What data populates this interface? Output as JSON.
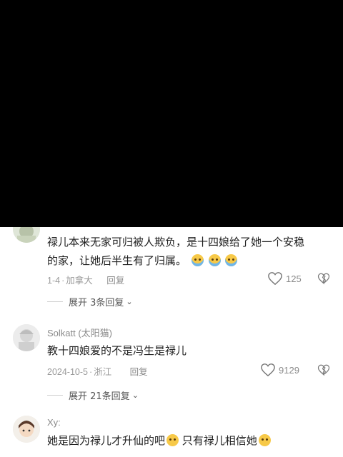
{
  "video": {},
  "comments": [
    {
      "text_line1": "禄儿本来无家可归被人欺负，是十四娘给了她一个安稳",
      "text_line2": "的家，让她后半生有了归属。",
      "emojis": [
        "loudly-crying-face",
        "loudly-crying-face",
        "loudly-crying-face"
      ],
      "date": "1-4",
      "location": "加拿大",
      "reply_label": "回复",
      "likes": "125",
      "expand_label": "展开 3条回复"
    },
    {
      "username": "Solkatt (太阳猫)",
      "text": "教十四娘爱的不是冯生是禄儿",
      "date": "2024-10-5",
      "location": "浙江",
      "reply_label": "回复",
      "likes": "9129",
      "expand_label": "展开 21条回复"
    },
    {
      "username": "Xy:",
      "text_a": "她是因为禄儿才升仙的吧",
      "text_b": "只有禄儿相信她",
      "emojis": [
        "pleading-face",
        "pleading-face"
      ]
    }
  ]
}
